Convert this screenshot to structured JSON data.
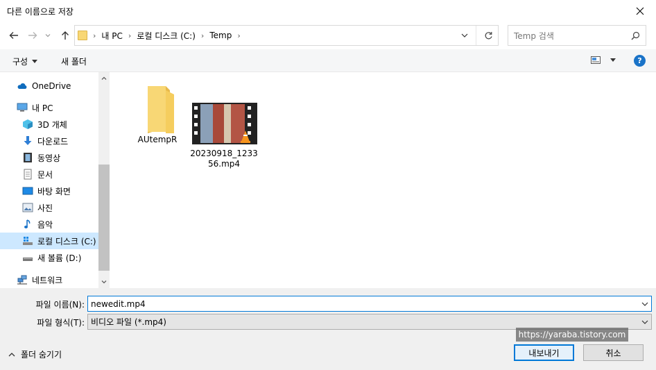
{
  "window": {
    "title": "다른 이름으로 저장"
  },
  "nav": {
    "address": [
      "내 PC",
      "로컬 디스크 (C:)",
      "Temp"
    ],
    "search_placeholder": "Temp 검색"
  },
  "toolbar": {
    "organize": "구성",
    "new_folder": "새 폴더"
  },
  "sidebar": {
    "items": [
      {
        "label": "OneDrive",
        "icon": "cloud-icon"
      },
      {
        "label": "내 PC",
        "icon": "computer-icon"
      },
      {
        "label": "3D 개체",
        "icon": "cube-icon"
      },
      {
        "label": "다운로드",
        "icon": "download-icon"
      },
      {
        "label": "동영상",
        "icon": "video-icon"
      },
      {
        "label": "문서",
        "icon": "document-icon"
      },
      {
        "label": "바탕 화면",
        "icon": "desktop-icon"
      },
      {
        "label": "사진",
        "icon": "picture-icon"
      },
      {
        "label": "음악",
        "icon": "music-icon"
      },
      {
        "label": "로컬 디스크 (C:)",
        "icon": "drive-icon"
      },
      {
        "label": "새 볼륨 (D:)",
        "icon": "drive-icon"
      },
      {
        "label": "네트워크",
        "icon": "network-icon"
      }
    ]
  },
  "files": [
    {
      "name": "AUtempR",
      "type": "folder"
    },
    {
      "name_line1": "20230918_1233",
      "name_line2": "56.mp4",
      "type": "video"
    }
  ],
  "form": {
    "filename_label": "파일 이름(N):",
    "filename_value": "newedit.mp4",
    "filetype_label": "파일 형식(T):",
    "filetype_value": "비디오 파일 (*.mp4)"
  },
  "buttons": {
    "save": "내보내기",
    "cancel": "취소",
    "hide_folders": "폴더 숨기기"
  },
  "watermark": "https://yaraba.tistory.com",
  "colors": {
    "accent": "#0078d7",
    "selected": "#cde8ff",
    "folder": "#f8d775",
    "help": "#1a73c8"
  }
}
